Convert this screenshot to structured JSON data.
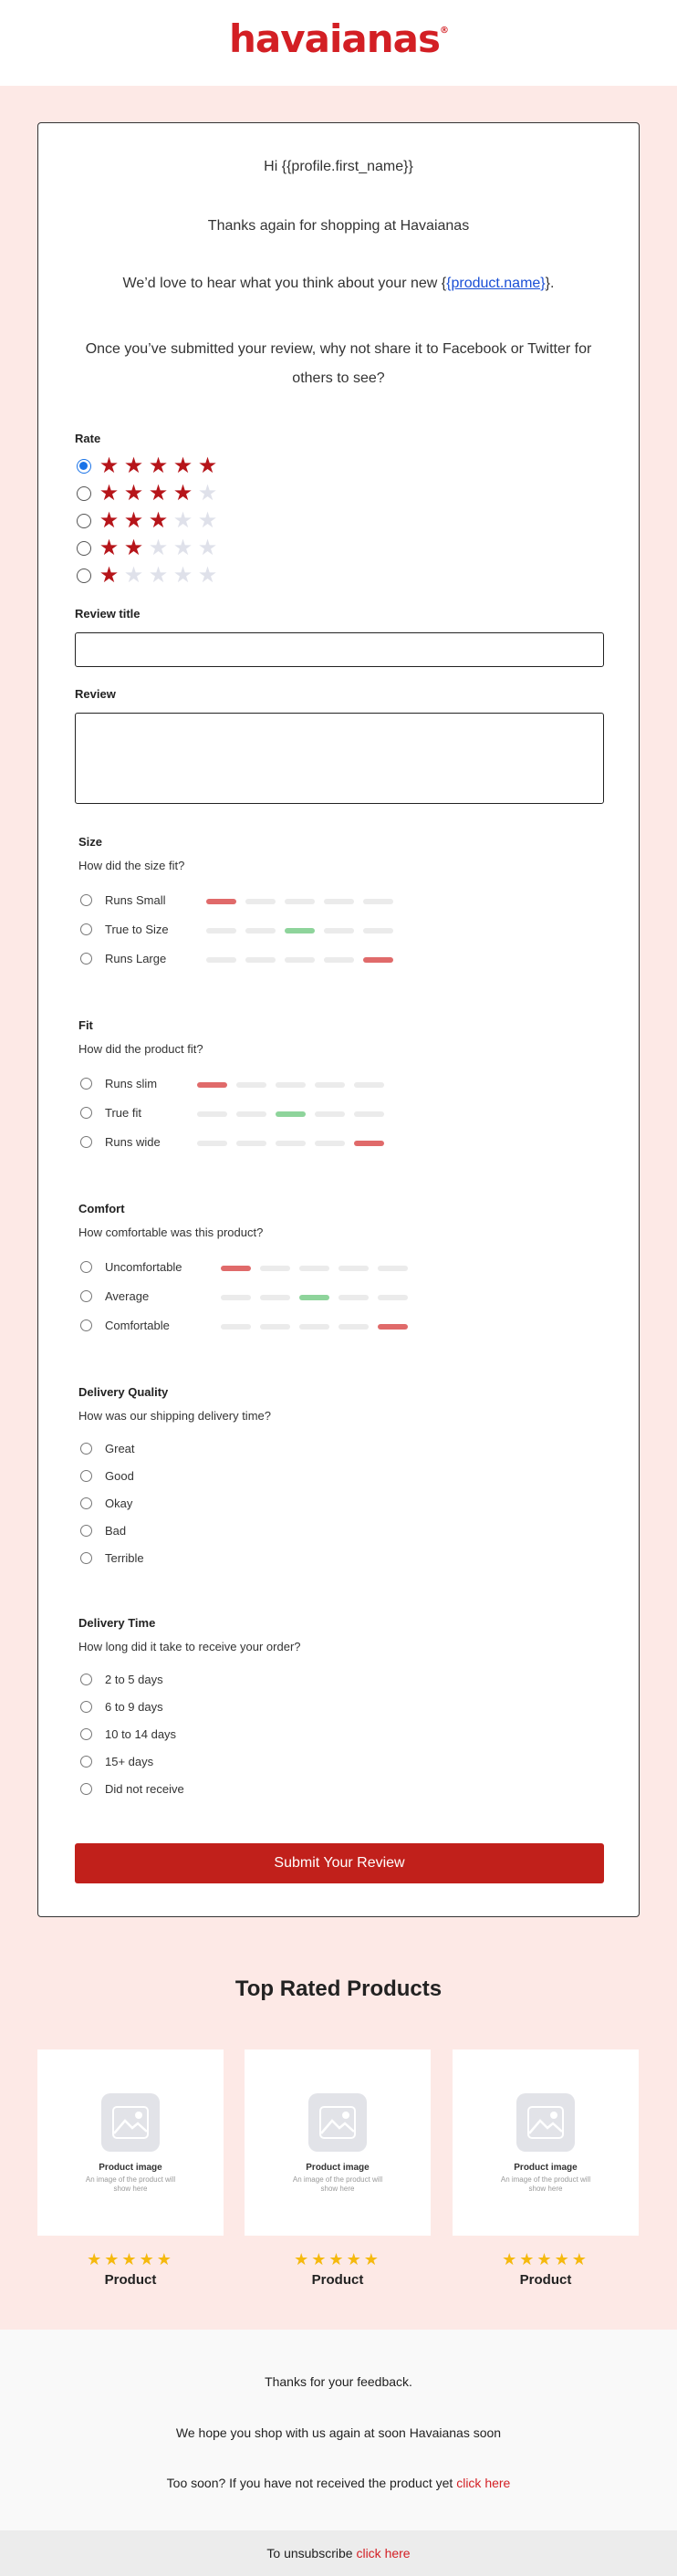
{
  "brand": {
    "logo_text": "havaianas",
    "logo_mark": "®",
    "accent": "#d31f24"
  },
  "intro": {
    "greeting": "Hi {{profile.first_name}}",
    "thanks": "Thanks again for shopping at Havaianas",
    "love_prefix": "We’d love to hear what you think about your new {",
    "product_link": "{product.name}",
    "love_suffix": "}.",
    "share_line1": "Once you’ve submitted your review, why not share it to Facebook or Twitter for",
    "share_line2": "others to see?"
  },
  "rate": {
    "label": "Rate",
    "options": [
      {
        "stars": 5,
        "selected": true
      },
      {
        "stars": 4,
        "selected": false
      },
      {
        "stars": 3,
        "selected": false
      },
      {
        "stars": 2,
        "selected": false
      },
      {
        "stars": 1,
        "selected": false
      }
    ]
  },
  "review_title": {
    "label": "Review title",
    "value": ""
  },
  "review": {
    "label": "Review",
    "value": ""
  },
  "size": {
    "title": "Size",
    "question": "How did the size fit?",
    "options": [
      {
        "label": "Runs Small",
        "level": 1,
        "color": "red"
      },
      {
        "label": "True to Size",
        "level": 3,
        "color": "green"
      },
      {
        "label": "Runs Large",
        "level": 5,
        "color": "red"
      }
    ]
  },
  "fit": {
    "title": "Fit",
    "question": "How did the product fit?",
    "options": [
      {
        "label": "Runs slim",
        "level": 1,
        "color": "red"
      },
      {
        "label": "True fit",
        "level": 3,
        "color": "green"
      },
      {
        "label": "Runs wide",
        "level": 5,
        "color": "red"
      }
    ]
  },
  "comfort": {
    "title": "Comfort",
    "question": "How comfortable was this product?",
    "options": [
      {
        "label": "Uncomfortable",
        "level": 1,
        "color": "red"
      },
      {
        "label": "Average",
        "level": 3,
        "color": "green"
      },
      {
        "label": "Comfortable",
        "level": 5,
        "color": "red"
      }
    ]
  },
  "delivery_quality": {
    "title": "Delivery Quality",
    "question": "How was our shipping delivery time?",
    "options": [
      "Great",
      "Good",
      "Okay",
      "Bad",
      "Terrible"
    ]
  },
  "delivery_time": {
    "title": "Delivery Time",
    "question": "How long did it take to receive your order?",
    "options": [
      "2 to 5 days",
      "6 to 9 days",
      "10 to 14 days",
      "15+ days",
      "Did not receive"
    ]
  },
  "submit_label": "Submit Your Review",
  "top_rated": {
    "title": "Top Rated Products",
    "products": [
      {
        "image_title": "Product image",
        "image_desc": "An image of the product will show here",
        "stars": "★★★★★",
        "name": "Product"
      },
      {
        "image_title": "Product image",
        "image_desc": "An image of the product will show here",
        "stars": "★★★★★",
        "name": "Product"
      },
      {
        "image_title": "Product image",
        "image_desc": "An image of the product will show here",
        "stars": "★★★★★",
        "name": "Product"
      }
    ]
  },
  "footer": {
    "line1": "Thanks for your feedback.",
    "line2": "We hope you shop with us again at soon Havaianas soon",
    "line3_prefix": "Too soon? If you have not received the product yet ",
    "line3_link": "click here",
    "unsub_prefix": "To unsubscribe ",
    "unsub_link": "click here"
  }
}
